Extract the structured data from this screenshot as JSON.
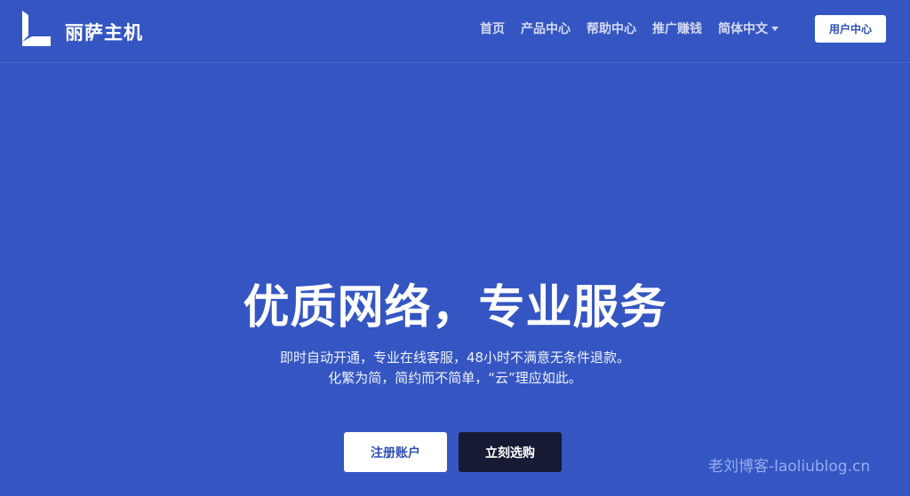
{
  "brand": {
    "name": "丽萨主机",
    "logo_icon": "brand-logo-icon"
  },
  "nav": {
    "items": [
      {
        "label": "首页"
      },
      {
        "label": "产品中心"
      },
      {
        "label": "帮助中心"
      },
      {
        "label": "推广赚钱"
      }
    ],
    "language": {
      "label": "简体中文",
      "icon": "caret-down-icon"
    },
    "user_center": "用户中心"
  },
  "hero": {
    "title": "优质网络，专业服务",
    "subtitle_line1": "即时自动开通，专业在线客服，48小时不满意无条件退款。",
    "subtitle_line2": "化繁为简，简约而不简单，“云”理应如此。",
    "register_label": "注册账户",
    "buy_label": "立刻选购"
  },
  "watermark": "老刘博客-laoliublog.cn",
  "colors": {
    "background": "#3556c2",
    "button_primary_text": "#2f4eb5",
    "button_dark": "#161a33",
    "white": "#ffffff"
  }
}
